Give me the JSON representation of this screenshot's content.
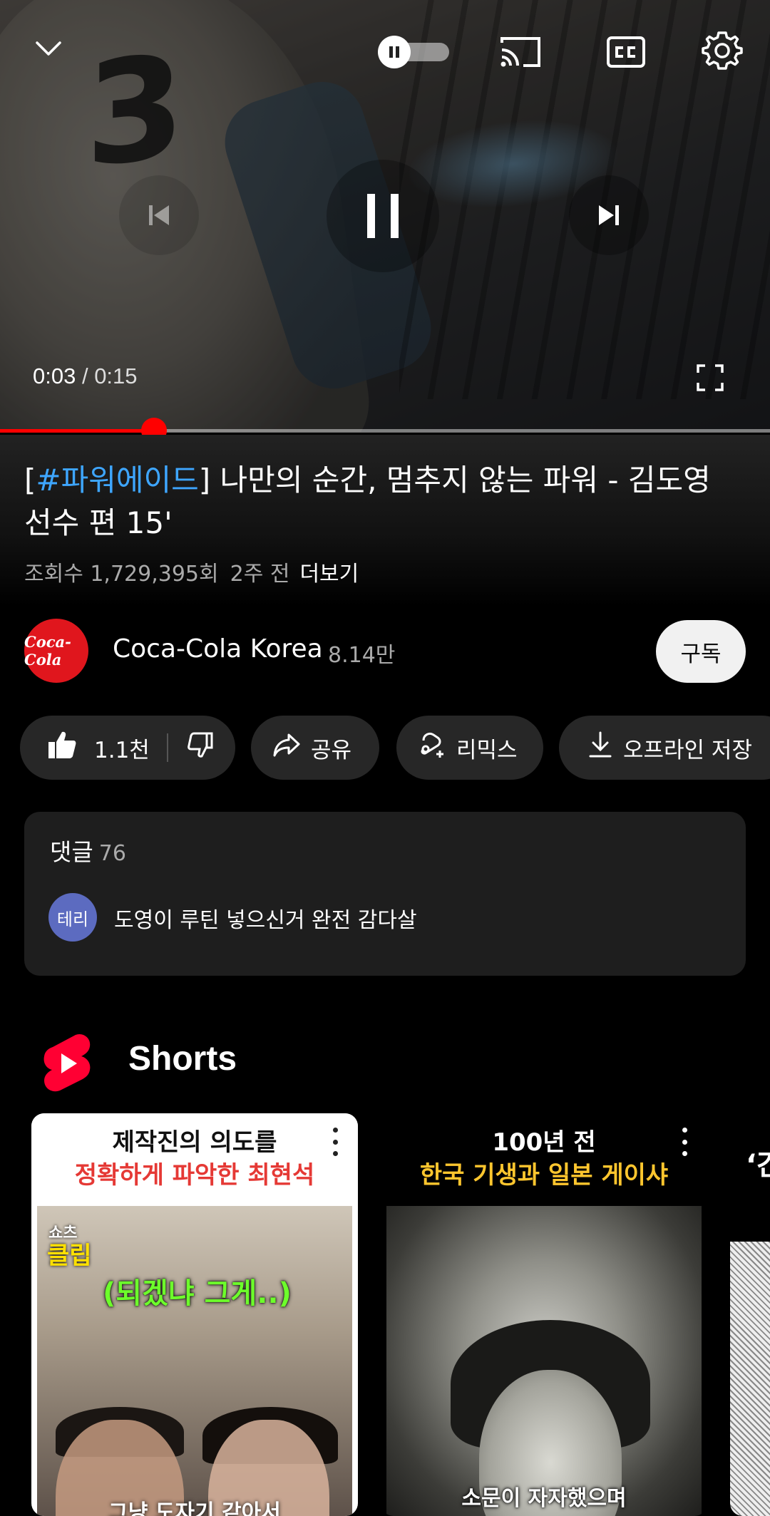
{
  "player": {
    "current_time": "0:03",
    "separator": " / ",
    "duration": "0:15",
    "jersey_number": "3",
    "progress_fraction": 0.2,
    "autoplay_on": false
  },
  "video": {
    "title_tag": "#파워에이드",
    "title_bracket_open": "[",
    "title_bracket_close": "]",
    "title_rest": " 나만의 순간, 멈추지 않는 파워 - 김도영 선수 편 15'",
    "views": "조회수 1,729,395회",
    "age": "2주 전",
    "more": "더보기"
  },
  "channel": {
    "avatar_text": "Coca-Cola",
    "name": "Coca-Cola Korea",
    "subscribers": "8.14만",
    "subscribe_label": "구독"
  },
  "actions": {
    "like_count": "1.1천",
    "share_label": "공유",
    "remix_label": "리믹스",
    "download_label": "오프라인 저장"
  },
  "comments": {
    "header": "댓글",
    "count": "76",
    "top_avatar": "테리",
    "top_text": "도영이 루틴 넣으신거 완전 감다살"
  },
  "shorts": {
    "title": "Shorts",
    "items": [
      {
        "line1": "제작진의 의도를",
        "line2": "정확하게 파악한 최현석",
        "badge_small": "쇼츠",
        "badge_big": "클립",
        "bubble": "(되겠냐 그게..)",
        "subtitle": "그냥 도자기 같아서"
      },
      {
        "line1": "100년 전",
        "line2": "한국 기생과 일본 게이샤",
        "subtitle": "소문이 자자했으며"
      },
      {
        "line1": "‘간"
      }
    ]
  },
  "colors": {
    "accent_red": "#ff0000",
    "link_blue": "#3ea6ff",
    "pill_bg": "#272727",
    "card_bg": "#1e1e1e"
  }
}
